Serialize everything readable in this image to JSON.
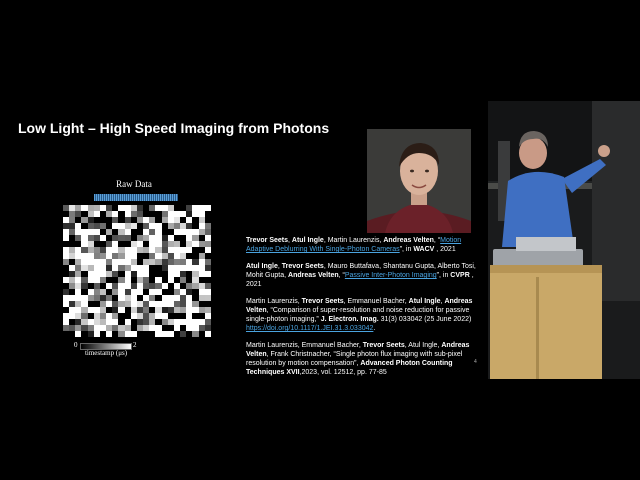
{
  "slide": {
    "title": "Low Light – High Speed Imaging from Photons",
    "raw_data_label": "Raw Data",
    "progress_fraction": 1.0,
    "colorbar": {
      "min_label": "0",
      "max_label": "2",
      "label": "timestamp (μs)"
    },
    "references": [
      {
        "parts": [
          {
            "text": "Trevor Seets",
            "style": "bold"
          },
          {
            "text": ", ",
            "style": "plain"
          },
          {
            "text": "Atul Ingle",
            "style": "bold"
          },
          {
            "text": ", Martin Laurenzis, ",
            "style": "plain"
          },
          {
            "text": "Andreas Velten",
            "style": "bold"
          },
          {
            "text": ", “",
            "style": "plain"
          },
          {
            "text": "Motion Adaptive Deblurring With Single-Photon Cameras",
            "style": "link"
          },
          {
            "text": "”, in ",
            "style": "plain"
          },
          {
            "text": "WACV",
            "style": "bold"
          },
          {
            "text": " , 2021",
            "style": "plain"
          }
        ]
      },
      {
        "parts": [
          {
            "text": "Atul Ingle",
            "style": "bold"
          },
          {
            "text": ", ",
            "style": "plain"
          },
          {
            "text": "Trevor Seets",
            "style": "bold"
          },
          {
            "text": ", Mauro Buttafava, Shantanu Gupta, Alberto Tosi, Mohit Gupta, ",
            "style": "plain"
          },
          {
            "text": "Andreas Velten",
            "style": "bold"
          },
          {
            "text": ", “",
            "style": "plain"
          },
          {
            "text": "Passive Inter-Photon Imaging",
            "style": "link"
          },
          {
            "text": "”, in ",
            "style": "plain"
          },
          {
            "text": "CVPR",
            "style": "bold"
          },
          {
            "text": " , 2021",
            "style": "plain"
          }
        ]
      },
      {
        "parts": [
          {
            "text": "Martin Laurenzis, ",
            "style": "plain"
          },
          {
            "text": "Trevor Seets",
            "style": "bold"
          },
          {
            "text": ", Emmanuel Bacher, ",
            "style": "plain"
          },
          {
            "text": "Atul Ingle",
            "style": "bold"
          },
          {
            "text": ", ",
            "style": "plain"
          },
          {
            "text": "Andreas Velten",
            "style": "bold"
          },
          {
            "text": ", “Comparison of super-resolution and noise reduction for passive single-photon imaging,” ",
            "style": "plain"
          },
          {
            "text": "J. Electron. Imag.",
            "style": "bold"
          },
          {
            "text": " 31(3) 033042 (25 June 2022) ",
            "style": "plain"
          },
          {
            "text": "https://doi.org/10.1117/1.JEI.31.3.033042",
            "style": "link"
          },
          {
            "text": ".",
            "style": "plain"
          }
        ]
      },
      {
        "parts": [
          {
            "text": "Martin Laurenzis, Emmanuel Bacher, ",
            "style": "plain"
          },
          {
            "text": "Trevor Seets",
            "style": "bold"
          },
          {
            "text": ", Atul Ingle, ",
            "style": "plain"
          },
          {
            "text": "Andreas Velten",
            "style": "bold"
          },
          {
            "text": ", Frank Christnacher, “Single photon flux imaging with sub-pixel resolution by motion compensation”, ",
            "style": "plain"
          },
          {
            "text": "Advanced Photon Counting Techniques XVII",
            "style": "bold"
          },
          {
            "text": ",2023, vol. 12512, pp. 77-85",
            "style": "plain"
          }
        ]
      }
    ],
    "slide_mark": "4"
  },
  "colors": {
    "background": "#000000",
    "link": "#4aa3df",
    "progress_bar": "#5aa0d8"
  },
  "icons": {
    "portrait": "person-photo",
    "speaker": "presenter-video"
  }
}
